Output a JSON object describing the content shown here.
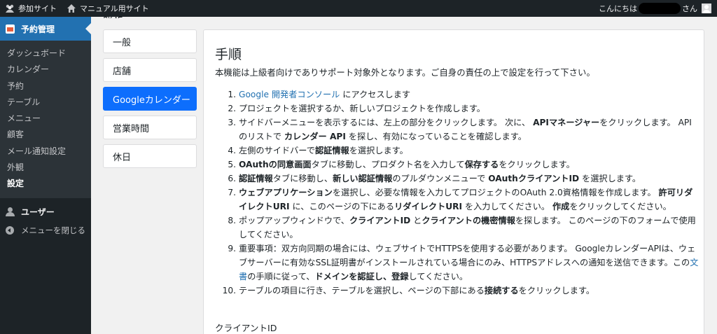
{
  "adminbar": {
    "site_name": "参加サイト",
    "manual_site": "マニュアル用サイト",
    "greeting_prefix": "こんにちは",
    "greeting_suffix": "さん"
  },
  "sidebar": {
    "current_menu": "予約管理",
    "submenu": [
      "ダッシュボード",
      "カレンダー",
      "予約",
      "テーブル",
      "メニュー",
      "顧客",
      "メール通知設定",
      "外観",
      "設定"
    ],
    "users": "ユーザー",
    "collapse": "メニューを閉じる"
  },
  "page": {
    "heading": "設定"
  },
  "tabs": [
    "一般",
    "店舗",
    "Googleカレンダー",
    "営業時間",
    "休日"
  ],
  "active_tab": "Googleカレンダー",
  "card": {
    "title": "手順",
    "intro": "本機能は上級者向けでありサポート対象外となります。ご自身の責任の上で設定を行って下さい。",
    "client_id_label": "クライアントID",
    "steps": [
      {
        "num": "1.",
        "parts": [
          {
            "t": "Google 開発者コンソール",
            "link": true
          },
          {
            "t": " にアクセスします"
          }
        ]
      },
      {
        "num": "2.",
        "parts": [
          {
            "t": "プロジェクトを選択するか、新しいプロジェクトを作成します。"
          }
        ]
      },
      {
        "num": "3.",
        "parts": [
          {
            "t": "サイドバーメニューを表示するには、左上の部分をクリックします。 次に、 "
          },
          {
            "t": "APIマネージャー",
            "b": true
          },
          {
            "t": "をクリックします。 APIのリストで "
          },
          {
            "t": "カレンダー API",
            "b": true
          },
          {
            "t": " を探し、有効になっていることを確認します。"
          }
        ]
      },
      {
        "num": "4.",
        "parts": [
          {
            "t": "左側のサイドバーで"
          },
          {
            "t": "認証情報",
            "b": true
          },
          {
            "t": "を選択します。"
          }
        ]
      },
      {
        "num": "5.",
        "parts": [
          {
            "t": "OAuthの同意画面",
            "b": true
          },
          {
            "t": "タブに移動し、プロダクト名を入力して"
          },
          {
            "t": "保存する",
            "b": true
          },
          {
            "t": "をクリックします。"
          }
        ]
      },
      {
        "num": "6.",
        "parts": [
          {
            "t": "認証情報",
            "b": true
          },
          {
            "t": "タブに移動し、"
          },
          {
            "t": "新しい認証情報",
            "b": true
          },
          {
            "t": "のプルダウンメニューで "
          },
          {
            "t": "OAuthクライアントID",
            "b": true
          },
          {
            "t": " を選択します。"
          }
        ]
      },
      {
        "num": "7.",
        "parts": [
          {
            "t": "ウェブアプリケーション",
            "b": true
          },
          {
            "t": "を選択し、必要な情報を入力してプロジェクトのOAuth 2.0資格情報を作成します。 "
          },
          {
            "t": "許可リダイレクトURI",
            "b": true
          },
          {
            "t": " に、このページの下にある"
          },
          {
            "t": "リダイレクトURI",
            "b": true
          },
          {
            "t": " を入力してください。 "
          },
          {
            "t": "作成",
            "b": true
          },
          {
            "t": "をクリックしてください。"
          }
        ]
      },
      {
        "num": "8.",
        "parts": [
          {
            "t": "ポップアップウィンドウで、"
          },
          {
            "t": "クライアントID",
            "b": true
          },
          {
            "t": " と"
          },
          {
            "t": "クライアントの機密情報",
            "b": true
          },
          {
            "t": "を探します。 このページの下のフォームで使用してください。"
          }
        ]
      },
      {
        "num": "9.",
        "parts": [
          {
            "t": "重要事項：双方向同期の場合には、ウェブサイトでHTTPSを使用する必要があります。 GoogleカレンダーAPIは、ウェブサーバーに有効なSSL証明書がインストールされている場合にのみ、HTTPSアドレスへの通知を送信できます。この"
          },
          {
            "t": "文書",
            "link": true
          },
          {
            "t": "の手順に従って、"
          },
          {
            "t": "ドメインを認証し、登録",
            "b": true
          },
          {
            "t": "してください。"
          }
        ]
      },
      {
        "num": "10.",
        "parts": [
          {
            "t": "テーブルの項目に行き、テーブルを選択し、ページの下部にある"
          },
          {
            "t": "接続する",
            "b": true
          },
          {
            "t": "をクリックします。"
          }
        ]
      }
    ]
  },
  "colors": {
    "accent": "#2271b1",
    "active_tab": "#0d6efd",
    "admin_dark": "#1d2327"
  }
}
